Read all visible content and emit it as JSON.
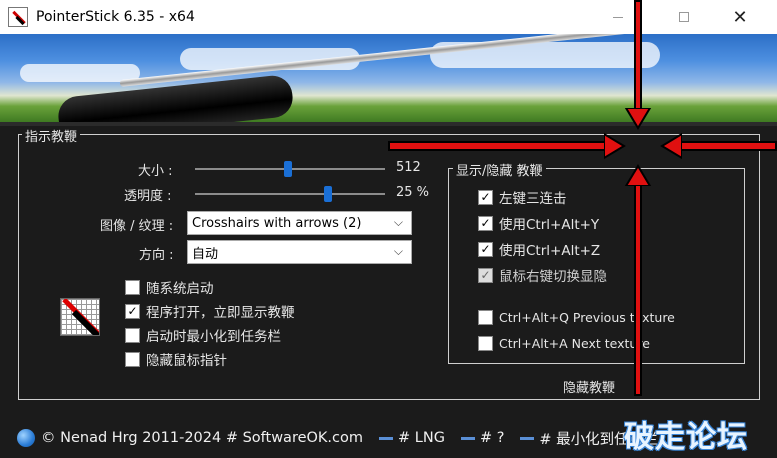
{
  "window": {
    "title": "PointerStick 6.35 - x64",
    "minimize_label": "—",
    "maximize_label": "☐",
    "close_label": "✕"
  },
  "main_group": {
    "title": "指示教鞭",
    "size_label": "大小 :",
    "size_value": "512",
    "size_position": 0.49,
    "opacity_label": "透明度 :",
    "opacity_value": "25 %",
    "opacity_position": 0.71,
    "texture_label": "图像 / 纹理 :",
    "texture_value": "Crosshairs with arrows (2)",
    "direction_label": "方向 :",
    "direction_value": "自动",
    "checkboxes": [
      {
        "label": "随系统启动",
        "checked": false
      },
      {
        "label": "程序打开，立即显示教鞭",
        "checked": true
      },
      {
        "label": "启动时最小化到任务栏",
        "checked": false
      },
      {
        "label": "隐藏鼠标指针",
        "checked": false
      }
    ]
  },
  "hotkey_group": {
    "title": "显示/隐藏 教鞭",
    "checkboxes": [
      {
        "label": "左键三连击",
        "checked": true,
        "disabled": false
      },
      {
        "label": "使用Ctrl+Alt+Y",
        "checked": true,
        "disabled": false
      },
      {
        "label": "使用Ctrl+Alt+Z",
        "checked": true,
        "disabled": false
      },
      {
        "label": "鼠标右键切换显隐",
        "checked": true,
        "disabled": true
      },
      {
        "label": "Ctrl+Alt+Q Previous texture",
        "checked": false,
        "disabled": false
      },
      {
        "label": "Ctrl+Alt+A Next texture",
        "checked": false,
        "disabled": false
      }
    ],
    "hide_button": "隐藏教鞭"
  },
  "statusbar": {
    "copyright": "© Nenad Hrg 2011-2024 # SoftwareOK.com",
    "lng": "# LNG",
    "help": "# ?",
    "minimize_tray": "# 最小化到任务栏"
  },
  "watermark": "破走论坛",
  "colors": {
    "accent": "#1a6fd6",
    "pointer_red": "#e01010"
  }
}
